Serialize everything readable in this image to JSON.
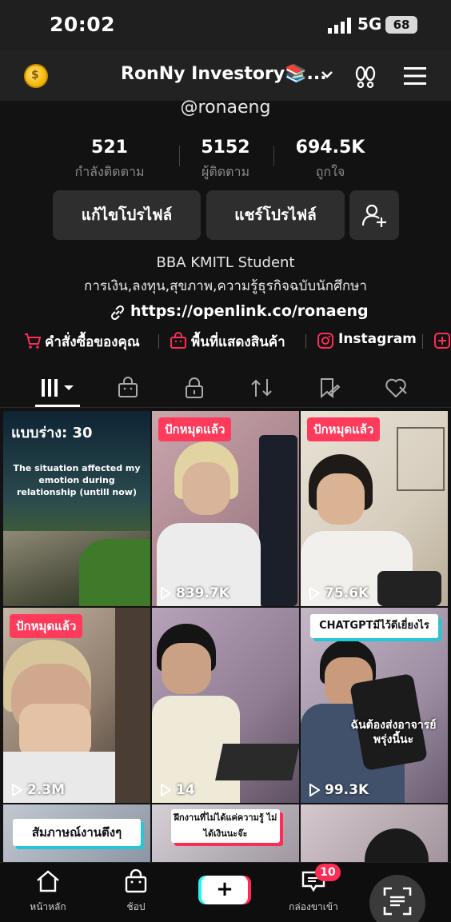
{
  "status_bar": {
    "time": "20:02",
    "network": "5G",
    "battery": "68"
  },
  "header": {
    "account_name": "RonNy Investory📚...",
    "coin_glyph": "$"
  },
  "profile": {
    "handle": "@ronaeng",
    "stats": [
      {
        "value": "521",
        "label": "กำลังติดตาม"
      },
      {
        "value": "5152",
        "label": "ผู้ติดตาม"
      },
      {
        "value": "694.5K",
        "label": "ถูกใจ"
      }
    ],
    "edit_button": "แก้ไขโปรไฟล์",
    "share_button": "แชร์โปรไฟล์",
    "bio_line1": "BBA KMITL Student",
    "bio_line2": "การเงิน,ลงทุน,สุขภาพ,ความรู้ธุรกิจฉบับนักศึกษา",
    "link": "https://openlink.co/ronaeng",
    "quick_links": {
      "orders": "คำสั่งซื้อของคุณ",
      "showcase": "พื้นที่แสดงสินค้า",
      "instagram": "Instagram"
    }
  },
  "colors": {
    "accent": "#fe2c55",
    "background": "#121212",
    "button": "#2e2e2e"
  },
  "videos": [
    {
      "draft_label": "แบบร่าง: 30",
      "caption": "The situation affected my emotion during relationship (untill now)"
    },
    {
      "pinned": "ปักหมุดแล้ว",
      "views": "839.7K"
    },
    {
      "pinned": "ปักหมุดแล้ว",
      "views": "75.6K"
    },
    {
      "pinned": "ปักหมุดแล้ว",
      "views": "2.3M"
    },
    {
      "views": "14"
    },
    {
      "title": "CHATGPTมีไว้ดีเยี่ยงไร",
      "subtitle": "ฉันต้องส่งอาจารย์พรุ่งนี้นะ",
      "views": "99.3K"
    },
    {
      "title": "สัมภาษณ์งานตึงๆ"
    },
    {
      "title": "ฝึกงานที่ไม่ได้แค่ความรู้ ไม่ได้เงินนะจ๊ะ"
    },
    {
      "title": ""
    }
  ],
  "bottom_nav": {
    "home": "หน้าหลัก",
    "shop": "ช้อป",
    "create": "+",
    "inbox": "กล่องขาเข้า",
    "inbox_badge": "10"
  }
}
